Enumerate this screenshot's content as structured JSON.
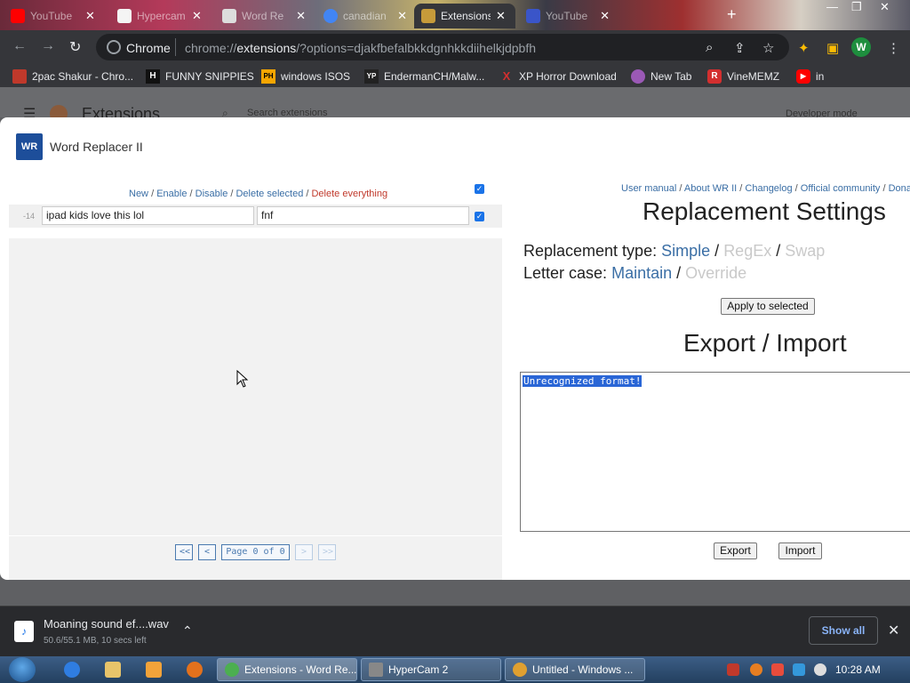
{
  "browser": {
    "tabs": [
      {
        "label": "YouTube",
        "icon": "youtube-icon",
        "color": "#ff0000"
      },
      {
        "label": "Hypercam",
        "icon": "hypercam-icon",
        "color": "#ffffff"
      },
      {
        "label": "Word Re",
        "icon": "image-icon",
        "color": "#dddddd"
      },
      {
        "label": "canadian",
        "icon": "google-icon",
        "color": "#4285f4"
      },
      {
        "label": "Extensions",
        "icon": "puzzle-icon",
        "color": "#c69b3a",
        "active": true
      },
      {
        "label": "YouTube",
        "icon": "youtube-icon",
        "color": "#3a55c9"
      }
    ],
    "new_tab_symbol": "+",
    "omnibox": {
      "site": "Chrome",
      "url_host": "chrome://",
      "url_bold": "extensions",
      "url_rest": "/?options=djakfbefalbkkdgnhkkdiihelkjdpbfh"
    },
    "profile_initial": "W"
  },
  "bookmarks": [
    {
      "label": "2pac Shakur - Chro...",
      "icon": "bookmark-favicon",
      "color": "#c0392b"
    },
    {
      "label": "FUNNY SNIPPIES",
      "icon": "h-icon",
      "glyph": "H",
      "color": "#111111"
    },
    {
      "label": "windows ISOS",
      "icon": "ph-icon",
      "glyph": "PH",
      "color": "#f7a600"
    },
    {
      "label": "EndermanCH/Malw...",
      "icon": "yp-icon",
      "glyph": "YP",
      "color": "#222222"
    },
    {
      "label": "XP Horror Download",
      "icon": "x-icon",
      "glyph": "X",
      "color": "#d32f2f"
    },
    {
      "label": "New Tab",
      "icon": "globe-icon",
      "glyph": "",
      "color": "#9b59b6"
    },
    {
      "label": "VineMEMZ",
      "icon": "r-icon",
      "glyph": "R",
      "color": "#d32f2f"
    },
    {
      "label": "in",
      "icon": "youtube-icon",
      "glyph": "▶",
      "color": "#ff0000"
    }
  ],
  "bg_page": {
    "title": "Extensions",
    "search_placeholder": "Search extensions",
    "developer_mode": "Developer mode"
  },
  "modal": {
    "title": "Word Replacer II",
    "logo": "WR",
    "row_actions": {
      "new": "New",
      "enable": "Enable",
      "disable": "Disable",
      "delete_selected": "Delete selected",
      "delete_everything": "Delete everything",
      "sep": " / "
    },
    "rule": {
      "number": "-14",
      "find": "ipad kids love this lol",
      "replace": "fnf",
      "checked": true
    },
    "pager": {
      "first": "<<",
      "prev": "<",
      "page": "Page 0 of 0",
      "next": ">",
      "last": ">>"
    },
    "top_links": {
      "manual": "User manual",
      "about": "About WR II",
      "changelog": "Changelog",
      "community": "Official community",
      "donate": "Donat"
    },
    "settings": {
      "title": "Replacement Settings",
      "type_label": "Replacement type:",
      "type_simple": "Simple",
      "type_regex": "RegEx",
      "type_swap": "Swap",
      "case_label": "Letter case:",
      "case_maintain": "Maintain",
      "case_override": "Override",
      "apply": "Apply to selected"
    },
    "export_import": {
      "title": "Export / Import",
      "text": "Unrecognized format!",
      "export": "Export",
      "import": "Import"
    }
  },
  "download": {
    "name": "Moaning sound ef....wav",
    "status": "50.6/55.1 MB, 10 secs left",
    "show_all": "Show all"
  },
  "taskbar": {
    "tasks": [
      {
        "label": "Extensions - Word Re...",
        "icon": "chrome-icon",
        "color": "#4caf50"
      },
      {
        "label": "HyperCam 2",
        "icon": "hypercam-icon",
        "color": "#888888"
      },
      {
        "label": "Untitled - Windows ...",
        "icon": "movie-maker-icon",
        "color": "#e0a030"
      }
    ],
    "clock": "10:28 AM"
  }
}
